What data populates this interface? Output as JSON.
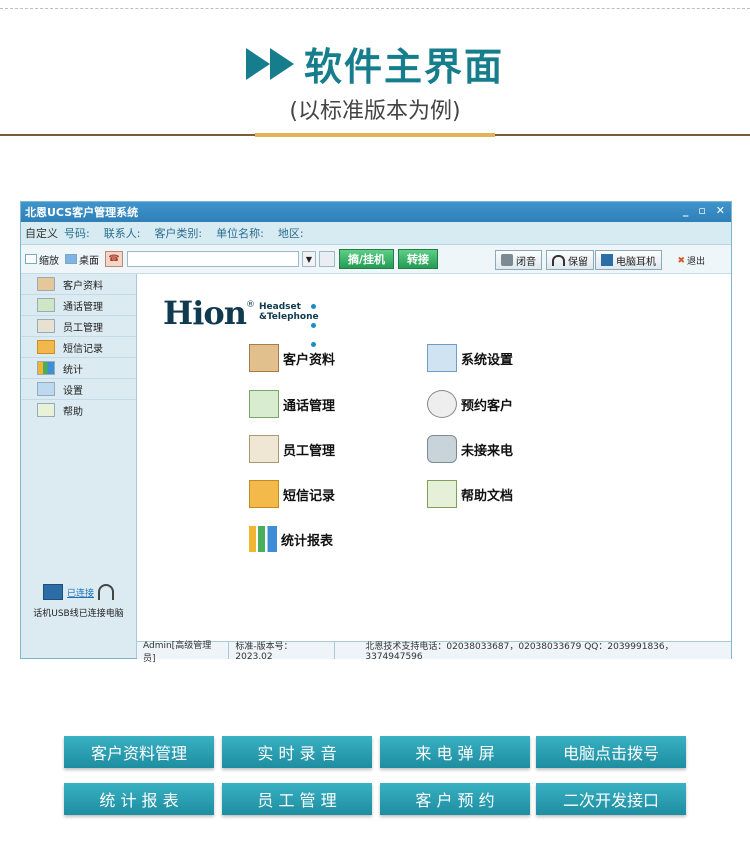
{
  "hero": {
    "title": "软件主界面",
    "subtitle": "(以标准版本为例)"
  },
  "app": {
    "window_title": "北恩UCS客户管理系统",
    "infobar": {
      "custom": "自定义",
      "fields": [
        "号码:",
        "联系人:",
        "客户类别:",
        "单位名称:",
        "地区:"
      ]
    },
    "toolbar": {
      "shrink_label": "缩放",
      "desktop_label": "桌面",
      "number_input": "",
      "answer_hangup": "摘/挂机",
      "transfer": "转接",
      "mute": "闭音",
      "hold": "保留",
      "pc_headset": "电脑耳机",
      "exit": "退出"
    },
    "sidebar": {
      "items": [
        "客户资料",
        "通话管理",
        "员工管理",
        "短信记录",
        "统计",
        "设置",
        "帮助"
      ],
      "connection": "已连接",
      "status_text": "话机USB线已连接电脑"
    },
    "logo": {
      "brand": "Hion",
      "reg": "®",
      "line1": "Headset",
      "line2": "&Telephone"
    },
    "functions": {
      "left": [
        "客户资料",
        "通话管理",
        "员工管理",
        "短信记录",
        "统计报表"
      ],
      "right": [
        "系统设置",
        "预约客户",
        "未接来电",
        "帮助文档"
      ]
    },
    "statusbar": {
      "user": "Admin[高级管理员]",
      "version": "标准-版本号：2023.02",
      "support": "北恩技术支持电话：02038033687，02038033679 QQ：2039991836，3374947596"
    }
  },
  "features": [
    "客户资料管理",
    "实 时 录 音",
    "来 电 弹 屏",
    "电脑点击拨号",
    "统 计 报 表",
    "员 工 管 理",
    "客 户 预 约",
    "二次开发接口"
  ],
  "colors": {
    "accent": "#157d8c",
    "button": "#2aa0b3",
    "titlebar": "#3a8fc6"
  }
}
